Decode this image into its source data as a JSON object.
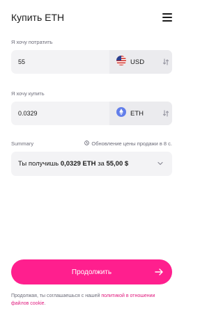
{
  "header": {
    "title": "Купить ETH",
    "menu_icon": "menu-icon"
  },
  "spend": {
    "label": "Я хочу потратить",
    "value": "55",
    "currency": "USD",
    "flag_icon": "us-flag-icon"
  },
  "buy": {
    "label": "Я хочу купить",
    "value": "0.0329",
    "currency": "ETH",
    "coin_icon": "eth-icon"
  },
  "summary": {
    "label": "Summary",
    "refresh_text": "Обновление цены продажи в 8 с.",
    "prefix": "Ты получишь",
    "amount": "0,0329 ETH",
    "middle": "за",
    "price": "55,00 $"
  },
  "cta": {
    "label": "Продолжить"
  },
  "footer": {
    "text": "Продолжая, ты соглашаешься с нашей",
    "link": "политикой в отношении файлов cookie",
    "end": "."
  },
  "colors": {
    "accent": "#ff1f8e",
    "link": "#e0197d",
    "eth": "#627eea"
  }
}
